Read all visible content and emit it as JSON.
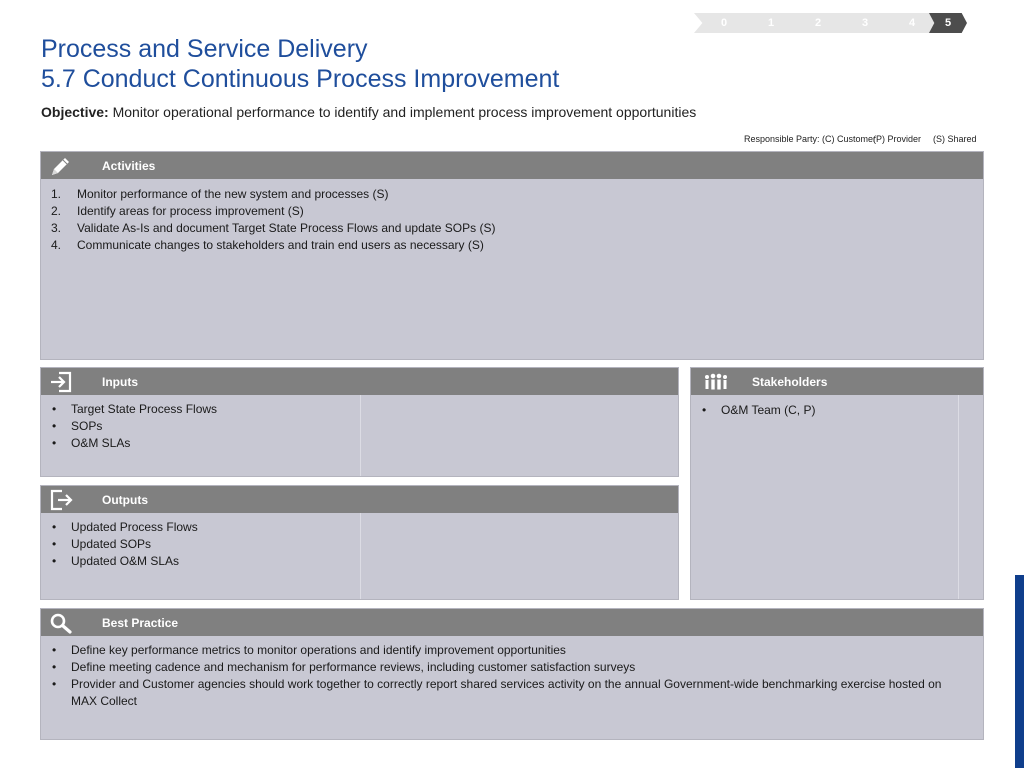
{
  "colors": {
    "title": "#1f4e9c",
    "step_inactive": "#e6e6e6",
    "step_active": "#4d4d4d",
    "panel_header": "#808080",
    "panel_body": "#c8c8d3",
    "accent_bar": "#0f3e8c"
  },
  "steps": {
    "items": [
      "0",
      "1",
      "2",
      "3",
      "4",
      "5"
    ],
    "active": "5"
  },
  "header": {
    "title_line1": "Process and Service Delivery",
    "title_line2": "5.7 Conduct Continuous Process Improvement",
    "objective_label": "Objective:",
    "objective_text": "Monitor operational performance to identify and implement process improvement opportunities"
  },
  "responsible": {
    "label": "Responsible Party: (C) Customer",
    "provider": "(P) Provider",
    "shared": "(S) Shared"
  },
  "activities": {
    "title": "Activities",
    "icon": "pencil-icon",
    "items": [
      {
        "num": "1.",
        "text": "Monitor performance of the new system and processes (S)"
      },
      {
        "num": "2.",
        "text": "Identify areas for process improvement (S)"
      },
      {
        "num": "3.",
        "text": "Validate As-Is and document Target State Process Flows and update SOPs (S)"
      },
      {
        "num": "4.",
        "text": "Communicate changes to stakeholders and train end users as necessary (S)"
      }
    ]
  },
  "inputs": {
    "title": "Inputs",
    "icon": "sign-in-icon",
    "items": [
      "Target State Process Flows",
      "SOPs",
      "O&M SLAs"
    ]
  },
  "outputs": {
    "title": "Outputs",
    "icon": "sign-out-icon",
    "items": [
      "Updated Process Flows",
      "Updated SOPs",
      "Updated O&M SLAs"
    ]
  },
  "stakeholders": {
    "title": "Stakeholders",
    "icon": "people-icon",
    "items": [
      "O&M Team (C, P)"
    ]
  },
  "best_practice": {
    "title": "Best Practice",
    "icon": "magnifier-icon",
    "items": [
      "Define key performance metrics to monitor operations and identify improvement opportunities",
      "Define meeting cadence and mechanism for performance reviews, including customer satisfaction surveys",
      "Provider and Customer agencies should work together to correctly report shared services activity on the annual Government-wide benchmarking exercise hosted on MAX Collect"
    ]
  }
}
